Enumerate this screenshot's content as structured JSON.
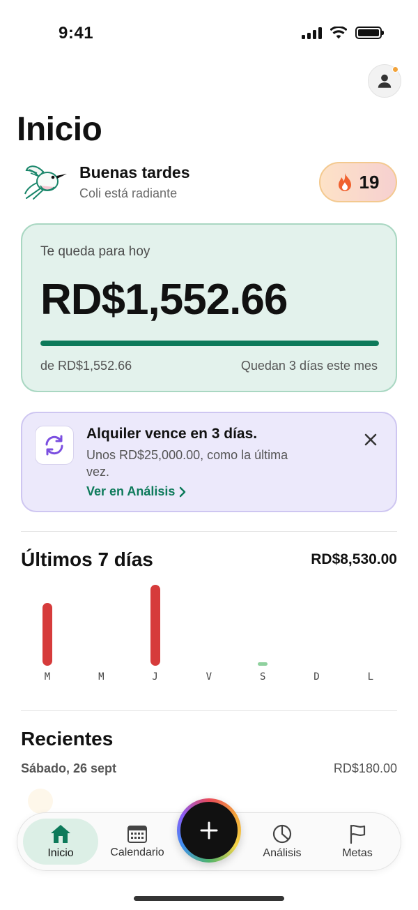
{
  "status_bar": {
    "time": "9:41"
  },
  "header": {
    "title": "Inicio"
  },
  "greeting": {
    "title": "Buenas tardes",
    "subtitle": "Coli está radiante",
    "streak": "19"
  },
  "budget": {
    "label": "Te queda para hoy",
    "amount": "RD$1,552.66",
    "total": "de RD$1,552.66",
    "days_left": "Quedan 3 días este mes",
    "progress": 1.0
  },
  "alert": {
    "title": "Alquiler vence en 3 días.",
    "body": "Unos RD$25,000.00, como la última vez.",
    "link": "Ver en Análisis"
  },
  "weekly": {
    "title": "Últimos 7 días",
    "total": "RD$8,530.00",
    "days": [
      "M",
      "M",
      "J",
      "V",
      "S",
      "D",
      "L"
    ],
    "values": [
      0.78,
      0,
      1.0,
      0,
      0.04,
      0,
      0
    ],
    "colors": [
      "#d63b3b",
      "#d63b3b",
      "#d63b3b",
      "#d63b3b",
      "#8fd19e",
      "#d63b3b",
      "#d63b3b"
    ]
  },
  "recents": {
    "title": "Recientes",
    "date": "Sábado, 26 sept",
    "amount": "RD$180.00"
  },
  "tabbar": {
    "tabs": [
      {
        "label": "Inicio",
        "icon": "home-icon"
      },
      {
        "label": "Calendario",
        "icon": "calendar-icon"
      },
      {
        "label": "Análisis",
        "icon": "pie-chart-icon"
      },
      {
        "label": "Metas",
        "icon": "flag-icon"
      }
    ],
    "fab_icon": "plus-icon"
  },
  "colors": {
    "accent": "#0d7a5a",
    "expense": "#d63b3b",
    "alert_bg": "#ece9fb",
    "budget_bg": "#e3f2ec"
  }
}
